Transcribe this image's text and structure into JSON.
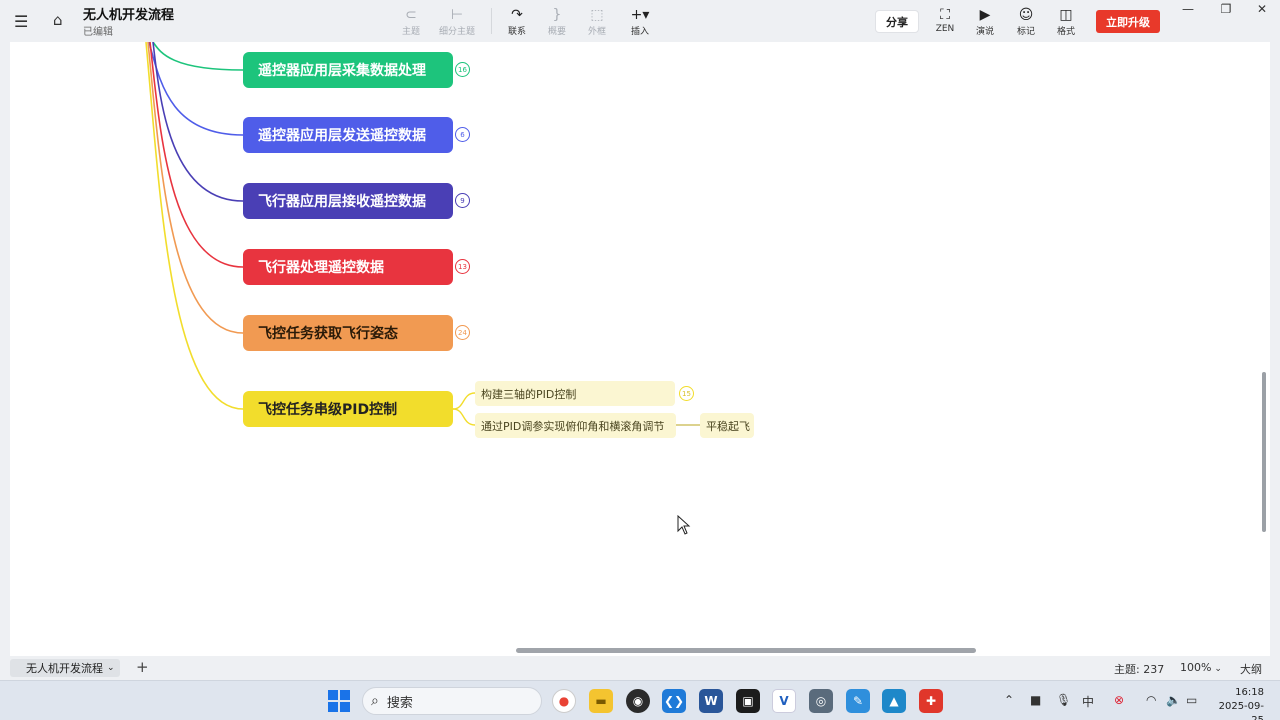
{
  "app": {
    "doc_title": "无人机开发流程",
    "doc_status": "已编辑"
  },
  "toolbar": {
    "items": [
      {
        "label": "主题",
        "icon": "topic-icon",
        "enabled": false
      },
      {
        "label": "细分主题",
        "icon": "subtopic-icon",
        "enabled": false
      },
      {
        "label": "联系",
        "icon": "relationship-icon",
        "enabled": true
      },
      {
        "label": "概要",
        "icon": "summary-icon",
        "enabled": false
      },
      {
        "label": "外框",
        "icon": "boundary-icon",
        "enabled": false
      },
      {
        "label": "插入",
        "icon": "insert-icon",
        "enabled": true
      }
    ],
    "share_label": "分享",
    "right_items": [
      {
        "label": "ZEN",
        "icon": "zen-icon"
      },
      {
        "label": "演说",
        "icon": "pitch-icon"
      },
      {
        "label": "标记",
        "icon": "marker-icon"
      },
      {
        "label": "格式",
        "icon": "format-icon"
      }
    ],
    "upgrade_label": "立即升级"
  },
  "mindmap": {
    "topics": [
      {
        "label": "遥控器应用层采集数据处理",
        "count": "16",
        "color": "#1dc47c"
      },
      {
        "label": "遥控器应用层发送遥控数据",
        "count": "6",
        "color": "#4f5de9"
      },
      {
        "label": "飞行器应用层接收遥控数据",
        "count": "9",
        "color": "#4a3fb5"
      },
      {
        "label": "飞行器处理遥控数据",
        "count": "13",
        "color": "#e8343f"
      },
      {
        "label": "飞控任务获取飞行姿态",
        "count": "24",
        "color": "#f19a52"
      },
      {
        "label": "飞控任务串级PID控制",
        "count": "",
        "color": "#f2dd2c"
      }
    ],
    "subtopics": [
      {
        "label": "构建三轴的PID控制",
        "count": "15"
      },
      {
        "label": "通过PID调参实现俯仰角和横滚角调节",
        "count": ""
      }
    ],
    "leaf": {
      "label": "平稳起飞"
    }
  },
  "sheets": {
    "active_tab": "无人机开发流程",
    "topic_count_label": "主题: 237",
    "zoom_label": "100%",
    "outline_label": "大纲"
  },
  "taskbar": {
    "search_placeholder": "搜索",
    "time": "16:18",
    "date": "2025-09-25"
  }
}
